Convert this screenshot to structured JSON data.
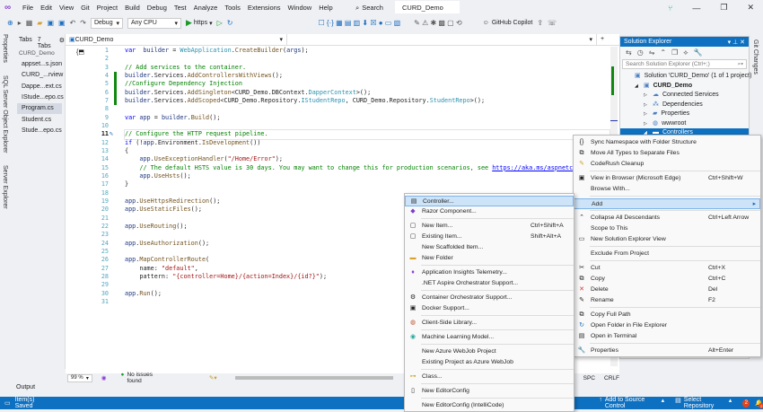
{
  "menu": [
    "File",
    "Edit",
    "View",
    "Git",
    "Project",
    "Build",
    "Debug",
    "Test",
    "Analyze",
    "Tools",
    "Extensions",
    "Window",
    "Help"
  ],
  "search_label": "Search",
  "window_title": "CURD_Demo",
  "toolbar": {
    "config": "Debug",
    "platform": "Any CPU",
    "run_target": "https",
    "copilot": "GitHub Copilot"
  },
  "left_strip": [
    "Properties",
    "SQL Server Object Explorer",
    "Server Explorer"
  ],
  "right_strip": [
    "Git Changes"
  ],
  "tabs_panel": {
    "title": "Tabs",
    "count": "7 Tabs",
    "group": "CURD_Demo",
    "files": [
      "appset...s.json",
      "CURD_...rview",
      "Dappe...ext.cs",
      "IStude...epo.cs",
      "Program.cs",
      "Student.cs",
      "Stude...epo.cs"
    ],
    "selected": 4
  },
  "editor": {
    "project_dropdown": "CURD_Demo",
    "current_line": 11,
    "lines": [
      [
        [
          "k",
          "var"
        ],
        [
          "",
          "  "
        ],
        [
          "v",
          "builder"
        ],
        [
          "",
          " = "
        ],
        [
          "t",
          "WebApplication"
        ],
        [
          "",
          "."
        ],
        [
          "m",
          "CreateBuilder"
        ],
        [
          "",
          "("
        ],
        [
          "v",
          "args"
        ],
        [
          "",
          ");"
        ]
      ],
      [],
      [
        [
          "c",
          "// Add services to the container."
        ]
      ],
      [
        [
          "v",
          "builder"
        ],
        [
          "",
          ".Services."
        ],
        [
          "m",
          "AddControllersWithViews"
        ],
        [
          "",
          "();"
        ]
      ],
      [
        [
          "c",
          "//Configure Dependency Injection"
        ]
      ],
      [
        [
          "v",
          "builder"
        ],
        [
          "",
          ".Services."
        ],
        [
          "m",
          "AddSingleton"
        ],
        [
          "",
          "<CURD_Demo.DBContext."
        ],
        [
          "t",
          "DapperContext"
        ],
        [
          "",
          ">();"
        ]
      ],
      [
        [
          "v",
          "builder"
        ],
        [
          "",
          ".Services."
        ],
        [
          "m",
          "AddScoped"
        ],
        [
          "",
          "<CURD_Demo.Repository."
        ],
        [
          "t",
          "IStudentRepo"
        ],
        [
          "",
          ", CURD_Demo.Repository."
        ],
        [
          "t",
          "StudentRepo"
        ],
        [
          "",
          ">();"
        ]
      ],
      [],
      [
        [
          "k",
          "var"
        ],
        [
          "",
          " "
        ],
        [
          "v",
          "app"
        ],
        [
          "",
          " = "
        ],
        [
          "v",
          "builder"
        ],
        [
          "",
          "."
        ],
        [
          "m",
          "Build"
        ],
        [
          "",
          "();"
        ]
      ],
      [],
      [
        [
          "c",
          "// Configure the HTTP request pipeline."
        ]
      ],
      [
        [
          "k",
          "if"
        ],
        [
          "",
          " (!"
        ],
        [
          "v",
          "app"
        ],
        [
          "",
          ".Environment."
        ],
        [
          "m",
          "IsDevelopment"
        ],
        [
          "",
          "())"
        ]
      ],
      [
        [
          "",
          "{"
        ]
      ],
      [
        [
          "",
          "    "
        ],
        [
          "v",
          "app"
        ],
        [
          "",
          "."
        ],
        [
          "m",
          "UseExceptionHandler"
        ],
        [
          "",
          "("
        ],
        [
          "s",
          "\"/Home/Error\""
        ],
        [
          "",
          ");"
        ]
      ],
      [
        [
          "",
          "    "
        ],
        [
          "c",
          "// The default HSTS value is 30 days. You may want to change this for production scenarios, see "
        ],
        [
          "lk",
          "https://aka.ms/aspnetcore-hsts"
        ]
      ],
      [
        [
          "",
          "    "
        ],
        [
          "v",
          "app"
        ],
        [
          "",
          "."
        ],
        [
          "m",
          "UseHsts"
        ],
        [
          "",
          "();"
        ]
      ],
      [
        [
          "",
          "}"
        ]
      ],
      [],
      [
        [
          "v",
          "app"
        ],
        [
          "",
          "."
        ],
        [
          "m",
          "UseHttpsRedirection"
        ],
        [
          "",
          "();"
        ]
      ],
      [
        [
          "v",
          "app"
        ],
        [
          "",
          "."
        ],
        [
          "m",
          "UseStaticFiles"
        ],
        [
          "",
          "();"
        ]
      ],
      [],
      [
        [
          "v",
          "app"
        ],
        [
          "",
          "."
        ],
        [
          "m",
          "UseRouting"
        ],
        [
          "",
          "();"
        ]
      ],
      [],
      [
        [
          "v",
          "app"
        ],
        [
          "",
          "."
        ],
        [
          "m",
          "UseAuthorization"
        ],
        [
          "",
          "();"
        ]
      ],
      [],
      [
        [
          "v",
          "app"
        ],
        [
          "",
          "."
        ],
        [
          "m",
          "MapControllerRoute"
        ],
        [
          "",
          "("
        ]
      ],
      [
        [
          "",
          "    name: "
        ],
        [
          "s",
          "\"default\""
        ],
        [
          "",
          ","
        ]
      ],
      [
        [
          "",
          "    pattern: "
        ],
        [
          "s",
          "\"{controller=Home}/{action=Index}/{id?}\""
        ],
        [
          "",
          ");"
        ]
      ],
      [],
      [
        [
          "v",
          "app"
        ],
        [
          "",
          "."
        ],
        [
          "m",
          "Run"
        ],
        [
          "",
          "();"
        ]
      ],
      []
    ],
    "zoom": "99 %",
    "issues": "No issues found",
    "encoding_items": [
      "SPC",
      "CRLF"
    ]
  },
  "solution_explorer": {
    "title": "Solution Explorer",
    "search_placeholder": "Search Solution Explorer (Ctrl+;)",
    "nodes": [
      {
        "label": "Solution 'CURD_Demo' (1 of 1 project)",
        "depth": 0,
        "icon": "solution-icon"
      },
      {
        "label": "CURD_Demo",
        "depth": 1,
        "icon": "project-icon",
        "bold": true
      },
      {
        "label": "Connected Services",
        "depth": 2,
        "icon": "cloud-icon"
      },
      {
        "label": "Dependencies",
        "depth": 2,
        "icon": "dependencies-icon"
      },
      {
        "label": "Properties",
        "depth": 2,
        "icon": "properties-icon"
      },
      {
        "label": "wwwroot",
        "depth": 2,
        "icon": "globe-icon"
      },
      {
        "label": "Controllers",
        "depth": 2,
        "icon": "folder-icon",
        "selected": true
      }
    ]
  },
  "context_menu": [
    {
      "label": "Sync Namespace with Folder Structure",
      "icon": "namespace-icon"
    },
    {
      "label": "Move All Types to Separate Files",
      "icon": "move-types-icon"
    },
    {
      "label": "CodeRush Cleanup",
      "icon": "cleanup-icon"
    },
    {
      "sep": true
    },
    {
      "label": "View in Browser (Microsoft Edge)",
      "shortcut": "Ctrl+Shift+W",
      "icon": "browser-icon"
    },
    {
      "label": "Browse With..."
    },
    {
      "sep": true
    },
    {
      "label": "Add",
      "submenu": true,
      "highlight": true
    },
    {
      "sep": true
    },
    {
      "label": "Collapse All Descendants",
      "shortcut": "Ctrl+Left Arrow",
      "icon": "collapse-icon"
    },
    {
      "label": "Scope to This"
    },
    {
      "label": "New Solution Explorer View",
      "icon": "new-view-icon"
    },
    {
      "sep": true
    },
    {
      "label": "Exclude From Project"
    },
    {
      "sep": true
    },
    {
      "label": "Cut",
      "shortcut": "Ctrl+X",
      "icon": "cut-icon"
    },
    {
      "label": "Copy",
      "shortcut": "Ctrl+C",
      "icon": "copy-icon"
    },
    {
      "label": "Delete",
      "shortcut": "Del",
      "icon": "delete-icon"
    },
    {
      "label": "Rename",
      "shortcut": "F2",
      "icon": "rename-icon"
    },
    {
      "sep": true
    },
    {
      "label": "Copy Full Path",
      "icon": "copy-path-icon"
    },
    {
      "label": "Open Folder in File Explorer",
      "icon": "open-folder-icon"
    },
    {
      "label": "Open in Terminal",
      "icon": "terminal-icon"
    },
    {
      "sep": true
    },
    {
      "label": "Properties",
      "shortcut": "Alt+Enter",
      "icon": "wrench-icon"
    }
  ],
  "add_submenu": [
    {
      "label": "Controller...",
      "icon": "controller-icon",
      "highlight": true
    },
    {
      "label": "Razor Component...",
      "icon": "razor-icon"
    },
    {
      "sep": true
    },
    {
      "label": "New Item...",
      "shortcut": "Ctrl+Shift+A",
      "icon": "new-item-icon"
    },
    {
      "label": "Existing Item...",
      "shortcut": "Shift+Alt+A",
      "icon": "existing-item-icon"
    },
    {
      "label": "New Scaffolded Item..."
    },
    {
      "label": "New Folder",
      "icon": "folder-icon"
    },
    {
      "sep": true
    },
    {
      "label": "Application Insights Telemetry...",
      "icon": "insights-icon"
    },
    {
      "label": ".NET Aspire Orchestrator Support..."
    },
    {
      "sep": true
    },
    {
      "label": "Container Orchestrator Support...",
      "icon": "container-icon"
    },
    {
      "label": "Docker Support...",
      "icon": "docker-icon"
    },
    {
      "sep": true
    },
    {
      "label": "Client-Side Library...",
      "icon": "library-icon"
    },
    {
      "sep": true
    },
    {
      "label": "Machine Learning Model...",
      "icon": "ml-icon"
    },
    {
      "sep": true
    },
    {
      "label": "New Azure WebJob Project"
    },
    {
      "label": "Existing Project as Azure WebJob"
    },
    {
      "sep": true
    },
    {
      "label": "Class...",
      "icon": "class-icon"
    },
    {
      "sep": true
    },
    {
      "label": "New EditorConfig",
      "icon": "file-icon"
    },
    {
      "sep": true
    },
    {
      "label": "New EditorConfig (IntelliCode)"
    }
  ],
  "output_label": "Output",
  "status": {
    "message": "Item(s) Saved",
    "source_control": "Add to Source Control",
    "repository": "Select Repository",
    "notifications": "2",
    "bell_count": "2"
  },
  "colors": {
    "accent": "#0e70c0",
    "highlight": "#cde3f7",
    "change_bar": "#108810"
  }
}
